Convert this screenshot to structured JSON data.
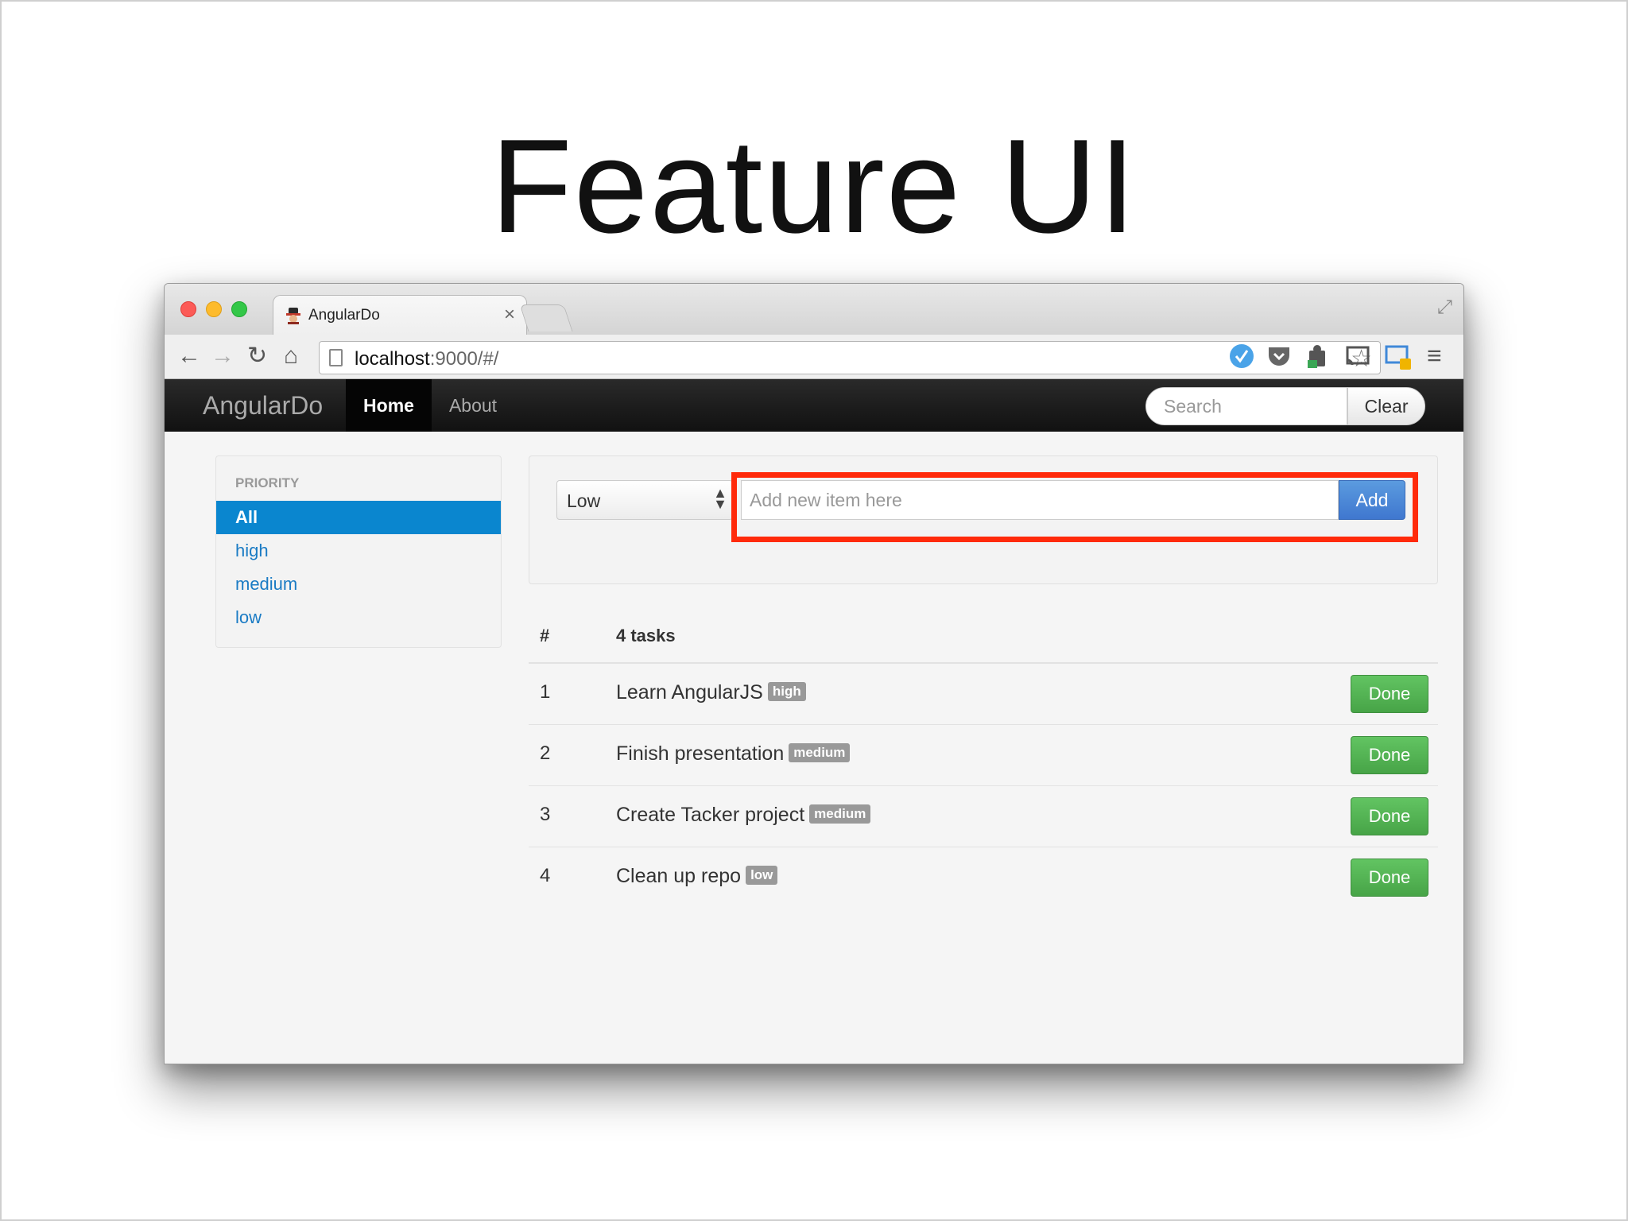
{
  "slide": {
    "title": "Feature UI"
  },
  "browser": {
    "tab_title": "AngularDo",
    "tab_close": "×",
    "url_host": "localhost",
    "url_path": ":9000/#/",
    "icons": {
      "back": "←",
      "forward": "→",
      "reload": "↻",
      "home": "⌂",
      "star": "☆",
      "menu": "≡",
      "fullscreen": "⤢"
    }
  },
  "app": {
    "brand": "AngularDo",
    "nav": [
      {
        "label": "Home",
        "active": true
      },
      {
        "label": "About",
        "active": false
      }
    ],
    "search_placeholder": "Search",
    "clear_label": "Clear"
  },
  "sidebar": {
    "header": "PRIORITY",
    "items": [
      {
        "label": "All",
        "active": true
      },
      {
        "label": "high"
      },
      {
        "label": "medium"
      },
      {
        "label": "low"
      }
    ]
  },
  "add_form": {
    "priority_selected": "Low",
    "input_placeholder": "Add new item here",
    "add_label": "Add",
    "highlight_color": "#ff2a0a"
  },
  "table": {
    "col_num": "#",
    "col_count": "4 tasks",
    "done_label": "Done",
    "rows": [
      {
        "num": "1",
        "title": "Learn AngularJS",
        "priority": "high"
      },
      {
        "num": "2",
        "title": "Finish presentation",
        "priority": "medium"
      },
      {
        "num": "3",
        "title": "Create Tacker project",
        "priority": "medium"
      },
      {
        "num": "4",
        "title": "Clean up repo",
        "priority": "low"
      }
    ]
  },
  "colors": {
    "accent": "#0a86cf",
    "add_button": "#4a85d6",
    "done_button": "#52b152",
    "navbar": "#1a1a1a"
  }
}
